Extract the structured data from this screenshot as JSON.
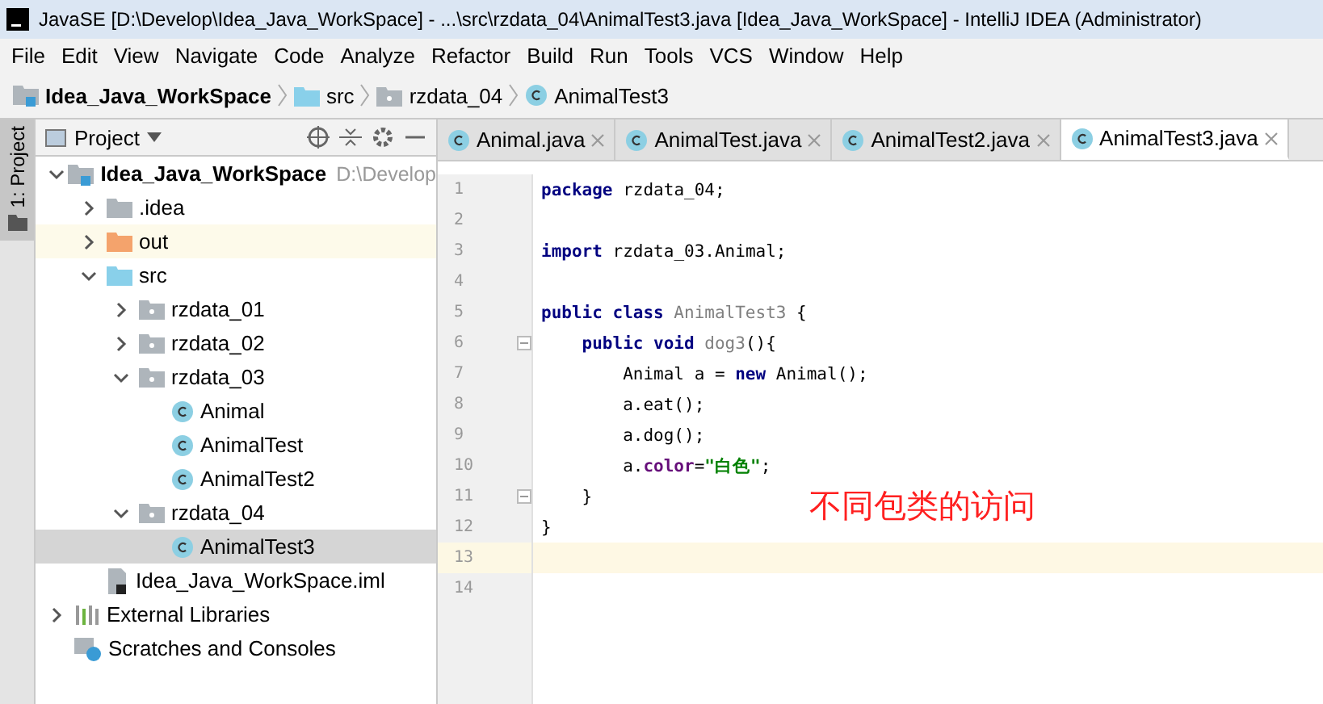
{
  "window": {
    "title": "JavaSE [D:\\Develop\\Idea_Java_WorkSpace] - ...\\src\\rzdata_04\\AnimalTest3.java [Idea_Java_WorkSpace] - IntelliJ IDEA (Administrator)"
  },
  "menu": [
    "File",
    "Edit",
    "View",
    "Navigate",
    "Code",
    "Analyze",
    "Refactor",
    "Build",
    "Run",
    "Tools",
    "VCS",
    "Window",
    "Help"
  ],
  "breadcrumb": [
    {
      "label": "Idea_Java_WorkSpace",
      "kind": "module"
    },
    {
      "label": "src",
      "kind": "source"
    },
    {
      "label": "rzdata_04",
      "kind": "package"
    },
    {
      "label": "AnimalTest3",
      "kind": "class"
    }
  ],
  "side_strip": {
    "label": "1: Project"
  },
  "project_panel": {
    "title": "Project",
    "tree": [
      {
        "label": "Idea_Java_WorkSpace",
        "hint": "D:\\Develop",
        "kind": "module",
        "expanded": true,
        "selected": false,
        "highlighted": false,
        "children": [
          {
            "label": ".idea",
            "kind": "folder",
            "expanded": false,
            "selected": false,
            "highlighted": false
          },
          {
            "label": "out",
            "kind": "excluded",
            "expanded": false,
            "selected": false,
            "highlighted": true
          },
          {
            "label": "src",
            "kind": "source",
            "expanded": true,
            "selected": false,
            "highlighted": false,
            "children": [
              {
                "label": "rzdata_01",
                "kind": "package",
                "expanded": false,
                "selected": false,
                "highlighted": false
              },
              {
                "label": "rzdata_02",
                "kind": "package",
                "expanded": false,
                "selected": false,
                "highlighted": false
              },
              {
                "label": "rzdata_03",
                "kind": "package",
                "expanded": true,
                "selected": false,
                "highlighted": false,
                "children": [
                  {
                    "label": "Animal",
                    "kind": "class",
                    "selected": false,
                    "highlighted": false
                  },
                  {
                    "label": "AnimalTest",
                    "kind": "class",
                    "selected": false,
                    "highlighted": false
                  },
                  {
                    "label": "AnimalTest2",
                    "kind": "class",
                    "selected": false,
                    "highlighted": false
                  }
                ]
              },
              {
                "label": "rzdata_04",
                "kind": "package",
                "expanded": true,
                "selected": false,
                "highlighted": false,
                "children": [
                  {
                    "label": "AnimalTest3",
                    "kind": "class",
                    "selected": true,
                    "highlighted": false
                  }
                ]
              }
            ]
          },
          {
            "label": "Idea_Java_WorkSpace.iml",
            "kind": "iml",
            "selected": false,
            "highlighted": false
          }
        ]
      },
      {
        "label": "External Libraries",
        "kind": "libraries",
        "expanded": false,
        "selected": false,
        "highlighted": false
      },
      {
        "label": "Scratches and Consoles",
        "kind": "scratches",
        "selected": false,
        "highlighted": false
      }
    ]
  },
  "tabs": [
    {
      "label": "Animal.java",
      "selected": false
    },
    {
      "label": "AnimalTest.java",
      "selected": false
    },
    {
      "label": "AnimalTest2.java",
      "selected": false
    },
    {
      "label": "AnimalTest3.java",
      "selected": true
    }
  ],
  "editor": {
    "lines": [
      {
        "number": "1",
        "fold": false,
        "current": false,
        "tokens": [
          {
            "text": "package",
            "kind": "keyword"
          },
          {
            "text": " rzdata_04;",
            "kind": "plain"
          }
        ]
      },
      {
        "number": "2",
        "fold": false,
        "current": false
      },
      {
        "number": "3",
        "fold": false,
        "current": false,
        "tokens": [
          {
            "text": "import",
            "kind": "keyword"
          },
          {
            "text": " rzdata_03.Animal;",
            "kind": "plain"
          }
        ]
      },
      {
        "number": "4",
        "fold": false,
        "current": false
      },
      {
        "number": "5",
        "fold": false,
        "current": false,
        "tokens": [
          {
            "text": "public class",
            "kind": "keyword"
          },
          {
            "text": " AnimalTest3",
            "kind": "unused"
          },
          {
            "text": " {",
            "kind": "plain"
          }
        ]
      },
      {
        "number": "6",
        "fold": true,
        "current": false,
        "tokens": [
          {
            "text": "    public void",
            "kind": "keyword"
          },
          {
            "text": " dog3",
            "kind": "unused"
          },
          {
            "text": "(){",
            "kind": "plain"
          }
        ]
      },
      {
        "number": "7",
        "fold": false,
        "current": false,
        "tokens": [
          {
            "text": "        Animal a = ",
            "kind": "plain"
          },
          {
            "text": "new",
            "kind": "keyword"
          },
          {
            "text": " Animal();",
            "kind": "plain"
          }
        ]
      },
      {
        "number": "8",
        "fold": false,
        "current": false,
        "tokens": [
          {
            "text": "        a.eat();",
            "kind": "plain"
          }
        ]
      },
      {
        "number": "9",
        "fold": false,
        "current": false,
        "tokens": [
          {
            "text": "        a.dog();",
            "kind": "plain"
          }
        ]
      },
      {
        "number": "10",
        "fold": false,
        "current": false,
        "tokens": [
          {
            "text": "        a.",
            "kind": "plain"
          },
          {
            "text": "color",
            "kind": "field"
          },
          {
            "text": "=",
            "kind": "plain"
          },
          {
            "text": "\"白色\"",
            "kind": "string"
          },
          {
            "text": ";",
            "kind": "plain"
          }
        ]
      },
      {
        "number": "11",
        "fold": true,
        "current": false,
        "tokens": [
          {
            "text": "    }",
            "kind": "plain"
          }
        ]
      },
      {
        "number": "12",
        "fold": false,
        "current": false,
        "tokens": [
          {
            "text": "}",
            "kind": "plain"
          }
        ]
      },
      {
        "number": "13",
        "fold": false,
        "current": true
      },
      {
        "number": "14",
        "fold": false,
        "current": false
      }
    ],
    "annotation": "不同包类的访问"
  }
}
